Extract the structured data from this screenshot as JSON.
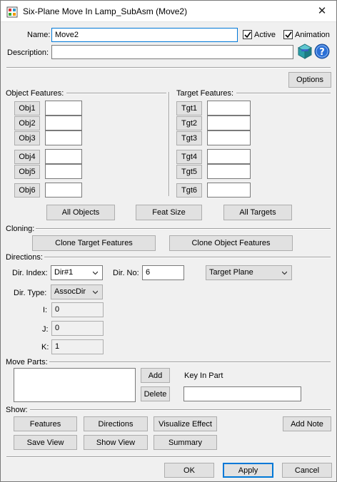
{
  "window": {
    "title": "Six-Plane Move In Lamp_SubAsm (Move2)",
    "close_glyph": "✕"
  },
  "header": {
    "name_label": "Name:",
    "name_value": "Move2",
    "active_label": "Active",
    "active_checked": true,
    "animation_label": "Animation",
    "animation_checked": true,
    "description_label": "Description:",
    "description_value": "",
    "options_label": "Options"
  },
  "object_features": {
    "label": "Object Features:",
    "items": [
      {
        "button": "Obj1",
        "value": ""
      },
      {
        "button": "Obj2",
        "value": ""
      },
      {
        "button": "Obj3",
        "value": ""
      },
      {
        "button": "Obj4",
        "value": ""
      },
      {
        "button": "Obj5",
        "value": ""
      },
      {
        "button": "Obj6",
        "value": ""
      }
    ]
  },
  "target_features": {
    "label": "Target Features:",
    "items": [
      {
        "button": "Tgt1",
        "value": ""
      },
      {
        "button": "Tgt2",
        "value": ""
      },
      {
        "button": "Tgt3",
        "value": ""
      },
      {
        "button": "Tgt4",
        "value": ""
      },
      {
        "button": "Tgt5",
        "value": ""
      },
      {
        "button": "Tgt6",
        "value": ""
      }
    ]
  },
  "feature_buttons": {
    "all_objects": "All Objects",
    "feat_size": "Feat Size",
    "all_targets": "All Targets"
  },
  "cloning": {
    "label": "Cloning:",
    "clone_target": "Clone Target Features",
    "clone_object": "Clone Object Features"
  },
  "directions": {
    "label": "Directions:",
    "dir_index_label": "Dir. Index:",
    "dir_index_value": "Dir#1",
    "dir_no_label": "Dir. No:",
    "dir_no_value": "6",
    "plane_value": "Target Plane",
    "dir_type_label": "Dir. Type:",
    "dir_type_value": "AssocDir",
    "i_label": "I:",
    "i_value": "0",
    "j_label": "J:",
    "j_value": "0",
    "k_label": "K:",
    "k_value": "1"
  },
  "move_parts": {
    "label": "Move Parts:",
    "add": "Add",
    "delete": "Delete",
    "key_in_label": "Key In Part",
    "key_in_value": ""
  },
  "show": {
    "label": "Show:",
    "features": "Features",
    "directions": "Directions",
    "visualize": "Visualize Effect",
    "add_note": "Add Note",
    "save_view": "Save View",
    "show_view": "Show View",
    "summary": "Summary"
  },
  "footer": {
    "ok": "OK",
    "apply": "Apply",
    "cancel": "Cancel"
  },
  "colors": {
    "accent": "#0078d7",
    "help_blue": "#2a6fd6",
    "cube_teal": "#2a9fa8"
  }
}
